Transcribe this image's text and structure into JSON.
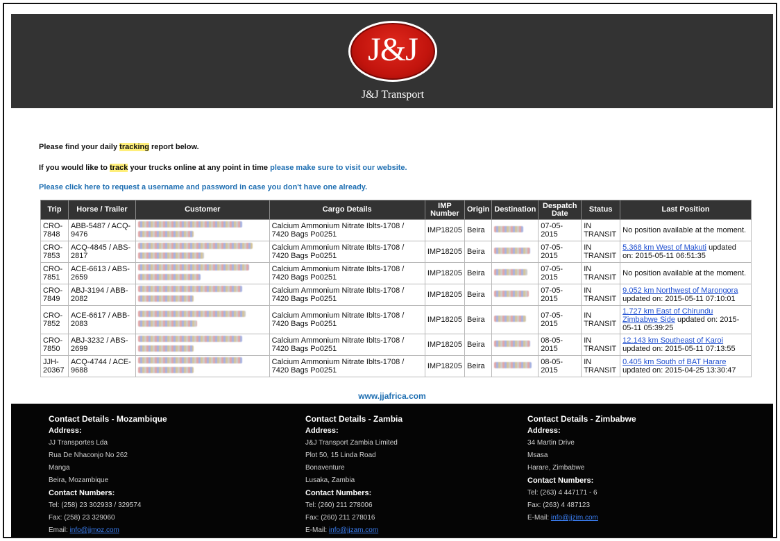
{
  "header": {
    "logo_mark": "J&J",
    "logo_text": "J&J Transport"
  },
  "intro": {
    "line1_pre": "Please find your daily ",
    "line1_hl": "tracking",
    "line1_post": " report below.",
    "line2_pre": "If you would like to ",
    "line2_hl": "track",
    "line2_mid": " your trucks online at any point in time ",
    "line2_link": "please make sure to visit our website.",
    "line3": "Please click here to request a username and password in case you don't have one already."
  },
  "table": {
    "headers": [
      "Trip",
      "Horse / Trailer",
      "Customer",
      "Cargo Details",
      "IMP Number",
      "Origin",
      "Destination",
      "Despatch Date",
      "Status",
      "Last Position"
    ],
    "rows": [
      {
        "trip": "CRO-7848",
        "horse": "ABB-5487 / ACQ-9476",
        "cargo": "Calcium Ammonium Nitrate Iblts-1708 / 7420 Bags Po0251",
        "imp": "IMP18205",
        "origin": "Beira",
        "date": "07-05-2015",
        "status": "IN TRANSIT",
        "pos_link": "",
        "pos_text": "No position available at the moment."
      },
      {
        "trip": "CRO-7853",
        "horse": "ACQ-4845 / ABS-2817",
        "cargo": "Calcium Ammonium Nitrate Iblts-1708 / 7420 Bags Po0251",
        "imp": "IMP18205",
        "origin": "Beira",
        "date": "07-05-2015",
        "status": "IN TRANSIT",
        "pos_link": "5.368 km West of Makuti",
        "pos_text": " updated on: 2015-05-11 06:51:35"
      },
      {
        "trip": "CRO-7851",
        "horse": "ACE-6613 / ABS-2659",
        "cargo": "Calcium Ammonium Nitrate Iblts-1708 / 7420 Bags Po0251",
        "imp": "IMP18205",
        "origin": "Beira",
        "date": "07-05-2015",
        "status": "IN TRANSIT",
        "pos_link": "",
        "pos_text": "No position available at the moment."
      },
      {
        "trip": "CRO-7849",
        "horse": "ABJ-3194 / ABB-2082",
        "cargo": "Calcium Ammonium Nitrate Iblts-1708 / 7420 Bags Po0251",
        "imp": "IMP18205",
        "origin": "Beira",
        "date": "07-05-2015",
        "status": "IN TRANSIT",
        "pos_link": "9.052 km Northwest of Marongora",
        "pos_text": " updated on: 2015-05-11 07:10:01"
      },
      {
        "trip": "CRO-7852",
        "horse": "ACE-6617 / ABB-2083",
        "cargo": "Calcium Ammonium Nitrate Iblts-1708 / 7420 Bags Po0251",
        "imp": "IMP18205",
        "origin": "Beira",
        "date": "07-05-2015",
        "status": "IN TRANSIT",
        "pos_link": "1.727 km East of Chirundu Zimbabwe Side",
        "pos_text": " updated on: 2015-05-11 05:39:25"
      },
      {
        "trip": "CRO-7850",
        "horse": "ABJ-3232 / ABS-2699",
        "cargo": "Calcium Ammonium Nitrate Iblts-1708 / 7420 Bags Po0251",
        "imp": "IMP18205",
        "origin": "Beira",
        "date": "08-05-2015",
        "status": "IN TRANSIT",
        "pos_link": "12.143 km Southeast of Karoi",
        "pos_text": " updated on: 2015-05-11 07:13:55"
      },
      {
        "trip": "JJH-20367",
        "horse": "ACQ-4744 / ACE-9688",
        "cargo": "Calcium Ammonium Nitrate Iblts-1708 / 7420 Bags Po0251",
        "imp": "IMP18205",
        "origin": "Beira",
        "date": "08-05-2015",
        "status": "IN TRANSIT",
        "pos_link": "0.405 km South of BAT Harare",
        "pos_text": " updated on: 2015-04-25 13:30:47"
      }
    ]
  },
  "website": "www.jjafrica.com",
  "footer": {
    "mozambique": {
      "title": "Contact Details - Mozambique",
      "address_label": "Address:",
      "address": [
        "JJ Transportes Lda",
        "Rua De Nhaconjo No 262",
        "Manga",
        "Beira, Mozambique"
      ],
      "contact_label": "Contact Numbers:",
      "tel": "Tel: (258) 23 302933 / 329574",
      "fax": "Fax: (258) 23 329060",
      "email_label": "Email: ",
      "email": "info@jjmoz.com"
    },
    "zambia": {
      "title": "Contact Details - Zambia",
      "address_label": "Address:",
      "address": [
        "J&J Transport Zambia Limited",
        "Plot 50, 15 Linda Road",
        "Bonaventure",
        "Lusaka, Zambia"
      ],
      "contact_label": "Contact Numbers:",
      "tel": "Tel: (260) 211 278006",
      "fax": "Fax: (260) 211 278016",
      "email_label": "E-Mail: ",
      "email": "info@jjzam.com"
    },
    "zimbabwe": {
      "title": "Contact Details - Zimbabwe",
      "address_label": "Address:",
      "address": [
        "34 Martin Drive",
        "Msasa",
        "Harare, Zimbabwe"
      ],
      "contact_label": "Contact Numbers:",
      "tel": "Tel: (263) 4 447171 - 6",
      "fax": "Fax: (263) 4 487123",
      "email_label": "E-Mail: ",
      "email": "info@jjzim.com"
    }
  }
}
